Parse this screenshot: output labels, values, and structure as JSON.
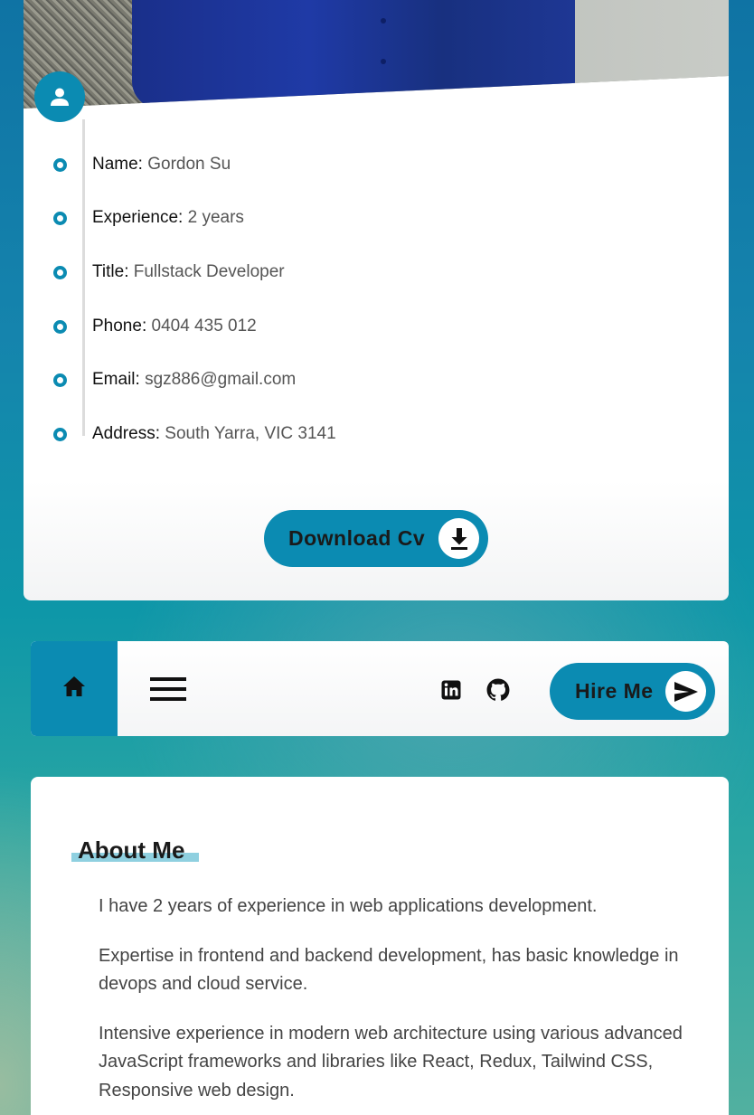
{
  "profile": {
    "info": [
      {
        "label": "Name:",
        "value": "Gordon Su"
      },
      {
        "label": "Experience:",
        "value": "2 years"
      },
      {
        "label": "Title:",
        "value": "Fullstack Developer"
      },
      {
        "label": "Phone:",
        "value": "0404 435 012"
      },
      {
        "label": "Email:",
        "value": "sgz886@gmail.com"
      },
      {
        "label": "Address:",
        "value": "South Yarra, VIC 3141"
      }
    ],
    "download_label": "Download Cv",
    "badge_icon": "person-icon"
  },
  "nav": {
    "home_icon": "home-icon",
    "menu_icon": "hamburger-menu-icon",
    "social": [
      "linkedin-icon",
      "github-icon"
    ],
    "hire_label": "Hire Me",
    "hire_icon": "send-icon"
  },
  "about": {
    "heading": "About Me",
    "paragraphs": [
      "I have 2 years of experience in web applications development.",
      "Expertise in frontend and backend development, has basic knowledge in devops and cloud service.",
      "Intensive experience in modern web architecture using various advanced JavaScript frameworks and libraries like React, Redux, Tailwind CSS, Responsive web design."
    ]
  },
  "colors": {
    "accent": "#0b8bb2",
    "highlight": "#8fd0e0"
  }
}
